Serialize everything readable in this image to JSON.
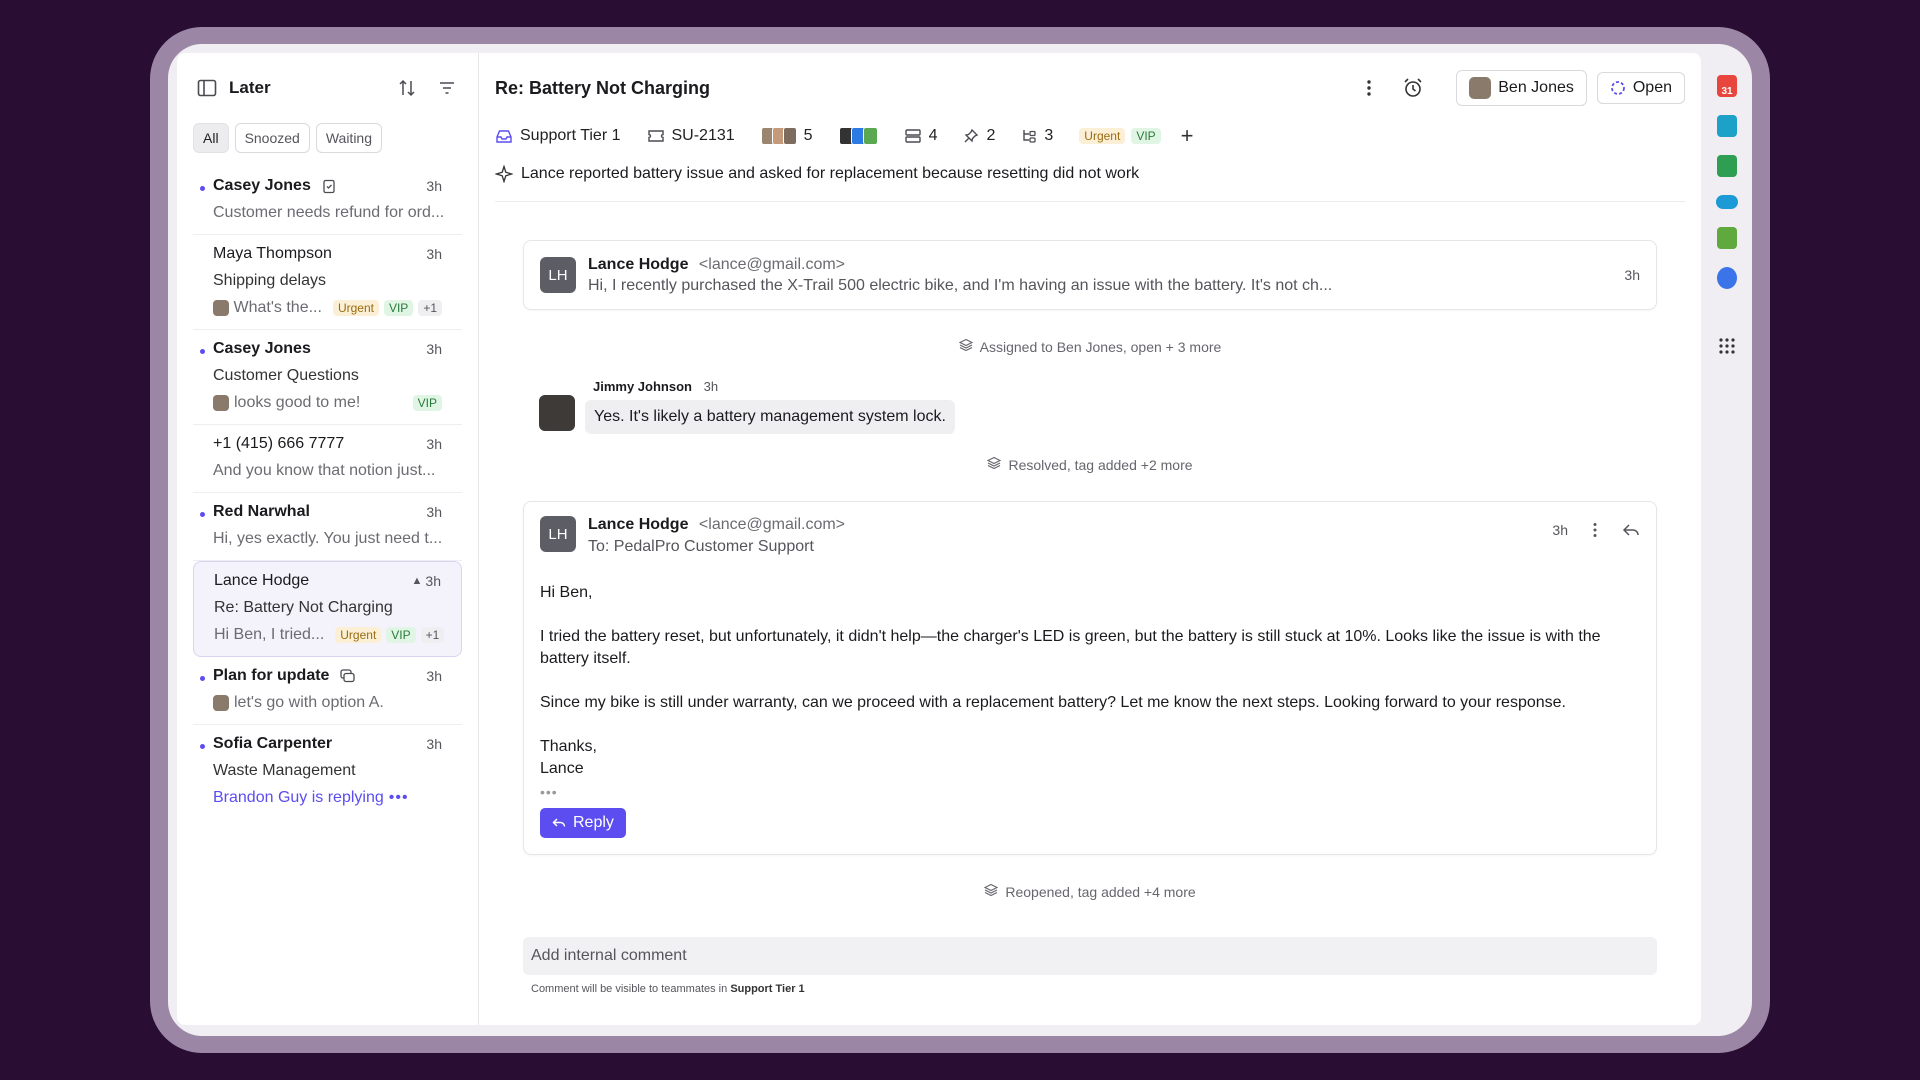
{
  "sidebar": {
    "title": "Later",
    "tabs": [
      {
        "label": "All"
      },
      {
        "label": "Snoozed"
      },
      {
        "label": "Waiting"
      }
    ],
    "items": [
      {
        "name": "Casey Jones",
        "time": "3h",
        "preview": "Customer needs refund for ord..."
      },
      {
        "name": "Maya Thompson",
        "time": "3h",
        "subject": "Shipping delays",
        "preview": "What's the...",
        "tags": [
          "Urgent",
          "VIP",
          "+1"
        ]
      },
      {
        "name": "Casey Jones",
        "time": "3h",
        "subject": "Customer Questions",
        "preview": "looks good to me!",
        "tags": [
          "VIP"
        ]
      },
      {
        "name": "+1 (415) 666 7777",
        "time": "3h",
        "preview": "And you know that notion just..."
      },
      {
        "name": "Red Narwhal",
        "time": "3h",
        "preview": "Hi, yes exactly. You just need t..."
      },
      {
        "name": "Lance Hodge",
        "time": "3h",
        "subject": "Re: Battery Not Charging",
        "preview": "Hi Ben, I tried...",
        "tags": [
          "Urgent",
          "VIP",
          "+1"
        ]
      },
      {
        "name": "Plan for update",
        "time": "3h",
        "preview": "let's go with option A."
      },
      {
        "name": "Sofia Carpenter",
        "time": "3h",
        "subject": "Waste Management",
        "preview": "Brandon Guy is replying"
      }
    ]
  },
  "header": {
    "title": "Re: Battery Not Charging",
    "assignee": "Ben Jones",
    "status": "Open"
  },
  "meta": {
    "inbox": "Support Tier 1",
    "ticket": "SU-2131",
    "participants": "5",
    "messages": "4",
    "pins": "2",
    "links": "3",
    "tags": [
      "Urgent",
      "VIP"
    ]
  },
  "summary": "Lance reported battery issue and asked for replacement because resetting did not work",
  "thread": {
    "msg1": {
      "initials": "LH",
      "from": "Lance Hodge",
      "email": "<lance@gmail.com>",
      "snippet": "Hi, I recently purchased the X-Trail 500 electric bike, and I'm having an issue with the battery. It's not ch...",
      "time": "3h"
    },
    "event1": "Assigned to Ben Jones, open + 3 more",
    "chat": {
      "author": "Jimmy Johnson",
      "time": "3h",
      "text": "Yes. It's likely a battery management system lock."
    },
    "event2": "Resolved, tag added +2 more",
    "msg2": {
      "initials": "LH",
      "from": "Lance Hodge",
      "email": "<lance@gmail.com>",
      "to": "To: PedalPro Customer Support",
      "time": "3h",
      "greeting": "Hi Ben,",
      "para1": "I tried the battery reset, but unfortunately, it didn't help—the charger's LED is green, but the battery is still stuck at 10%. Looks like the issue is with the battery itself.",
      "para2": "Since my bike is still under warranty, can we proceed with a replacement battery? Let me know the next steps. Looking forward to your response.",
      "signoff1": "Thanks,",
      "signoff2": "Lance",
      "reply_label": "Reply"
    },
    "event3": "Reopened, tag added +4 more"
  },
  "comment": {
    "placeholder": "Add internal comment",
    "hint_prefix": "Comment will be visible to teammates in",
    "hint_team": "Support Tier 1"
  },
  "colors": {
    "accent": "#5b4df0",
    "urgent_bg": "#fbf0d6",
    "vip_bg": "#e0f5e4",
    "background": "#2a0d33"
  }
}
